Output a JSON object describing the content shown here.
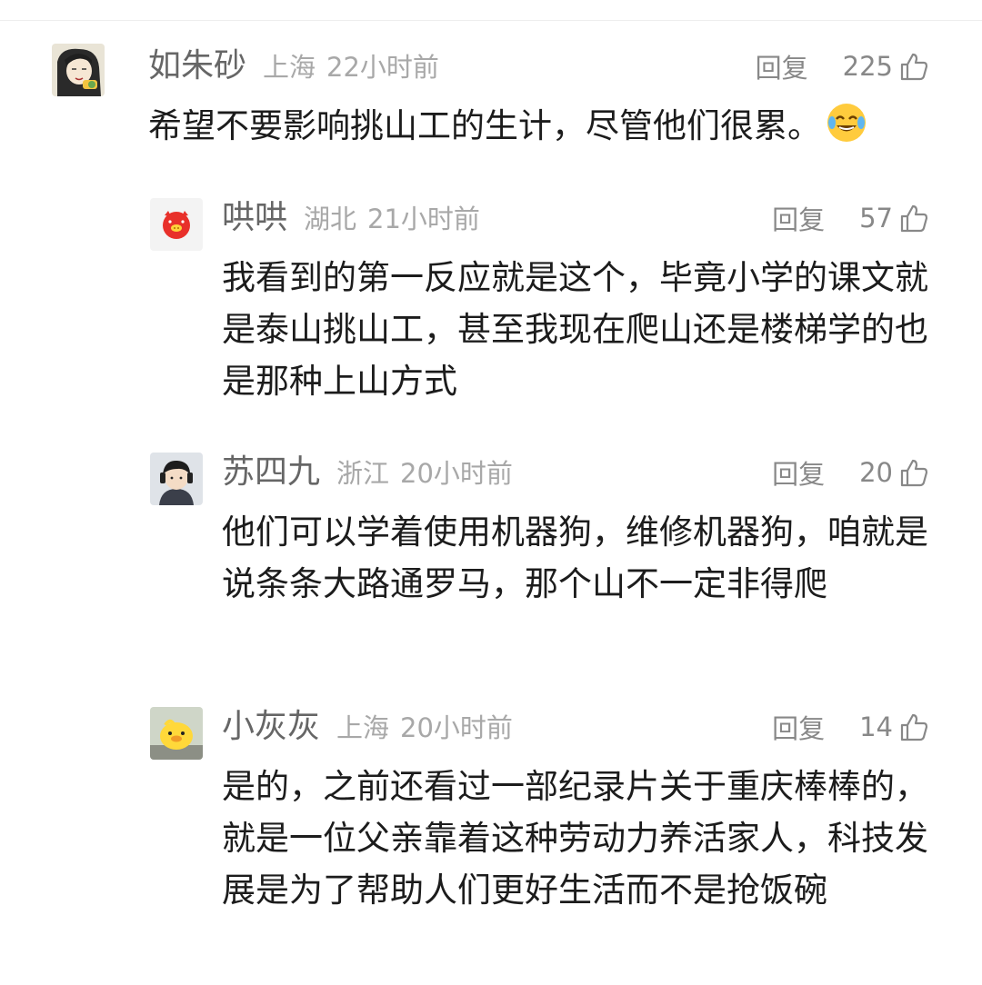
{
  "comments": [
    {
      "name": "如朱砂",
      "location": "上海",
      "time": "22小时前",
      "reply_label": "回复",
      "likes": "225",
      "text": "希望不要影响挑山工的生计，尽管他们很累。",
      "emoji": "crying-laughing-emoji",
      "avatar": "cartoon-girl-avatar"
    },
    {
      "name": "哄哄",
      "location": "湖北",
      "time": "21小时前",
      "reply_label": "回复",
      "likes": "57",
      "text": "我看到的第一反应就是这个，毕竟小学的课文就是泰山挑山工，甚至我现在爬山还是楼梯学的也是那种上山方式",
      "avatar": "red-pig-avatar"
    },
    {
      "name": "苏四九",
      "location": "浙江",
      "time": "20小时前",
      "reply_label": "回复",
      "likes": "20",
      "text": "他们可以学着使用机器狗，维修机器狗，咱就是说条条大路通罗马，那个山不一定非得爬",
      "avatar": "boy-headphones-avatar"
    },
    {
      "name": "小灰灰",
      "location": "上海",
      "time": "20小时前",
      "reply_label": "回复",
      "likes": "14",
      "text": "是的，之前还看过一部纪录片关于重庆棒棒的，就是一位父亲靠着这种劳动力养活家人，科技发展是为了帮助人们更好生活而不是抢饭碗",
      "avatar": "yellow-duck-avatar"
    }
  ],
  "colors": {
    "name": "#666666",
    "meta": "#a8a8a8",
    "action": "#888888",
    "text": "#1c1c1c"
  }
}
